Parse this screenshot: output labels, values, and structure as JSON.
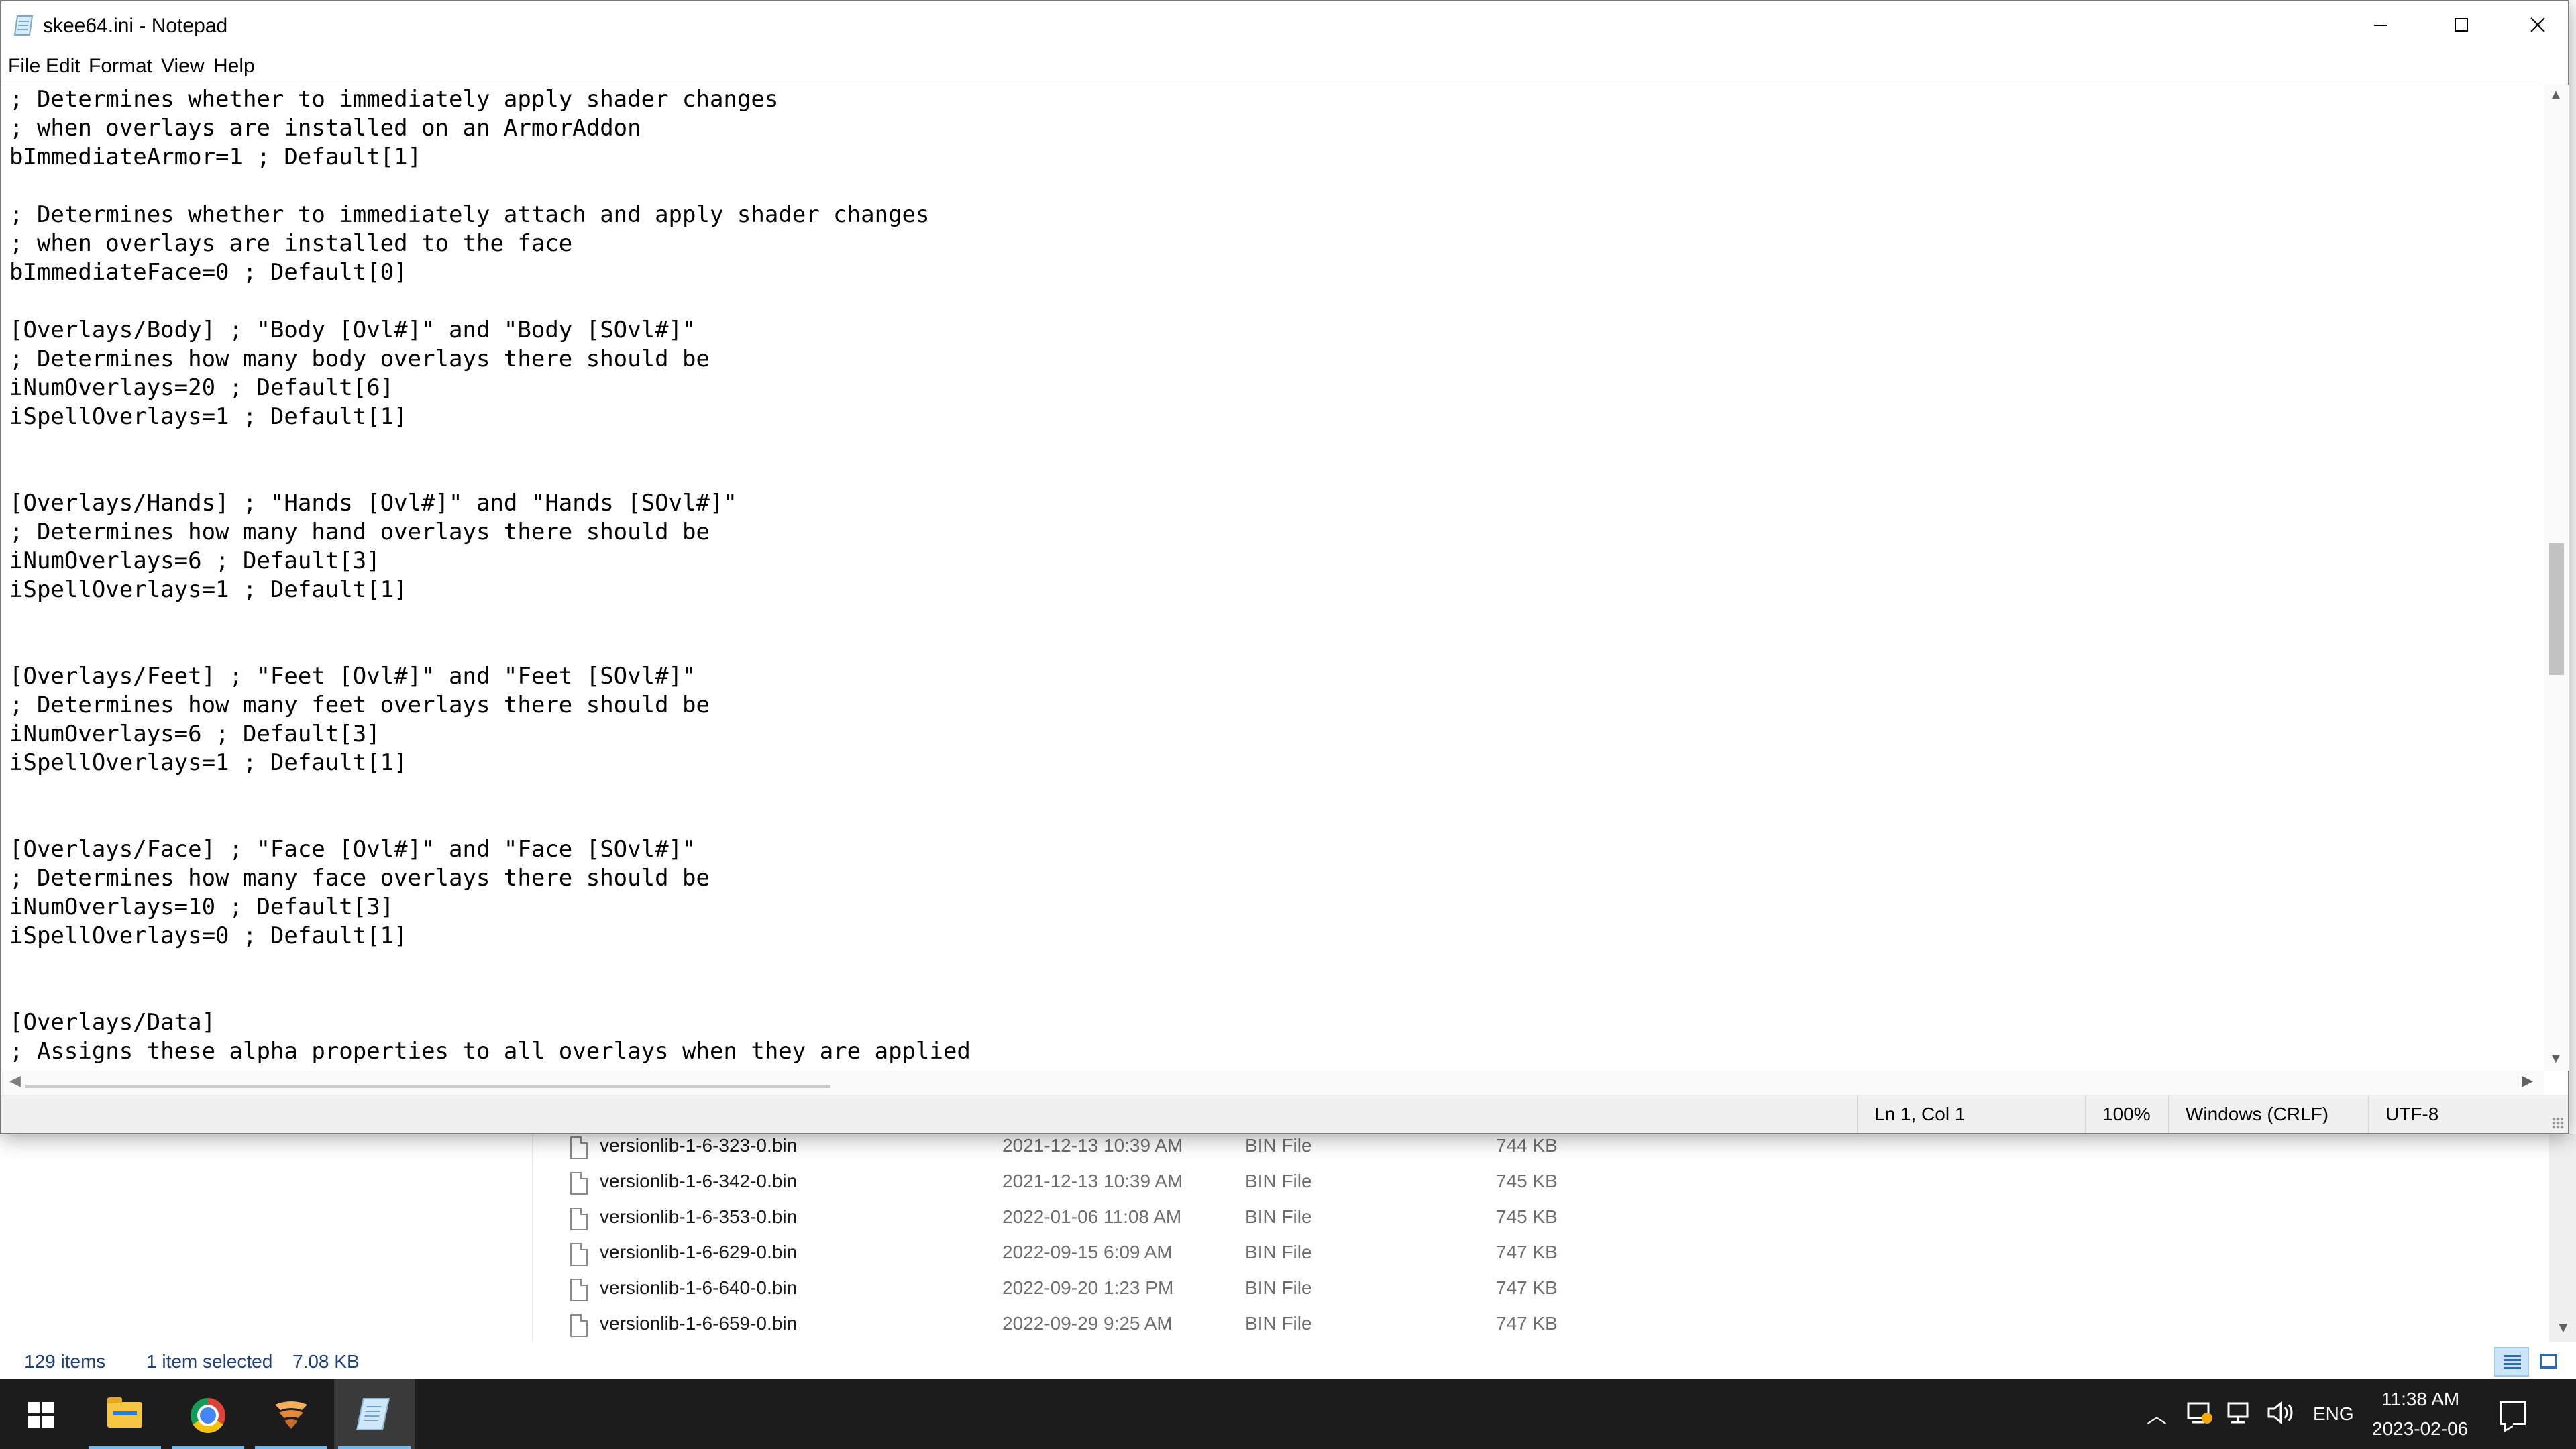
{
  "explorer": {
    "files": [
      {
        "name": "versionlib-1-6-323-0.bin",
        "date": "2021-12-13 10:39 AM",
        "type": "BIN File",
        "size": "744 KB"
      },
      {
        "name": "versionlib-1-6-342-0.bin",
        "date": "2021-12-13 10:39 AM",
        "type": "BIN File",
        "size": "745 KB"
      },
      {
        "name": "versionlib-1-6-353-0.bin",
        "date": "2022-01-06 11:08 AM",
        "type": "BIN File",
        "size": "745 KB"
      },
      {
        "name": "versionlib-1-6-629-0.bin",
        "date": "2022-09-15 6:09 AM",
        "type": "BIN File",
        "size": "747 KB"
      },
      {
        "name": "versionlib-1-6-640-0.bin",
        "date": "2022-09-20 1:23 PM",
        "type": "BIN File",
        "size": "747 KB"
      },
      {
        "name": "versionlib-1-6-659-0.bin",
        "date": "2022-09-29 9:25 AM",
        "type": "BIN File",
        "size": "747 KB"
      }
    ],
    "status": {
      "item_count": "129 items",
      "selection": "1 item selected",
      "selection_size": "7.08 KB"
    }
  },
  "notepad": {
    "title": "skee64.ini - Notepad",
    "menu": [
      "File",
      "Edit",
      "Format",
      "View",
      "Help"
    ],
    "lines": [
      "; Determines whether to immediately apply shader changes",
      "; when overlays are installed on an ArmorAddon",
      "bImmediateArmor=1 ; Default[1]",
      "",
      "; Determines whether to immediately attach and apply shader changes",
      "; when overlays are installed to the face",
      "bImmediateFace=0 ; Default[0]",
      "",
      "[Overlays/Body] ; \"Body [Ovl#]\" and \"Body [SOvl#]\"",
      "; Determines how many body overlays there should be",
      "iNumOverlays=20 ; Default[6]",
      "iSpellOverlays=1 ; Default[1]",
      "",
      "",
      "[Overlays/Hands] ; \"Hands [Ovl#]\" and \"Hands [SOvl#]\"",
      "; Determines how many hand overlays there should be",
      "iNumOverlays=6 ; Default[3]",
      "iSpellOverlays=1 ; Default[1]",
      "",
      "",
      "[Overlays/Feet] ; \"Feet [Ovl#]\" and \"Feet [SOvl#]\"",
      "; Determines how many feet overlays there should be",
      "iNumOverlays=6 ; Default[3]",
      "iSpellOverlays=1 ; Default[1]",
      "",
      "",
      "[Overlays/Face] ; \"Face [Ovl#]\" and \"Face [SOvl#]\"",
      "; Determines how many face overlays there should be",
      "iNumOverlays=10 ; Default[3]",
      "iSpellOverlays=0 ; Default[1]",
      "",
      "",
      "[Overlays/Data]",
      "; Assigns these alpha properties to all overlays when they are applied"
    ],
    "status": {
      "position": "Ln 1, Col 1",
      "zoom": "100%",
      "line_ending": "Windows (CRLF)",
      "encoding": "UTF-8"
    }
  },
  "taskbar": {
    "language": "ENG",
    "time": "11:38 AM",
    "date": "2023-02-06"
  }
}
